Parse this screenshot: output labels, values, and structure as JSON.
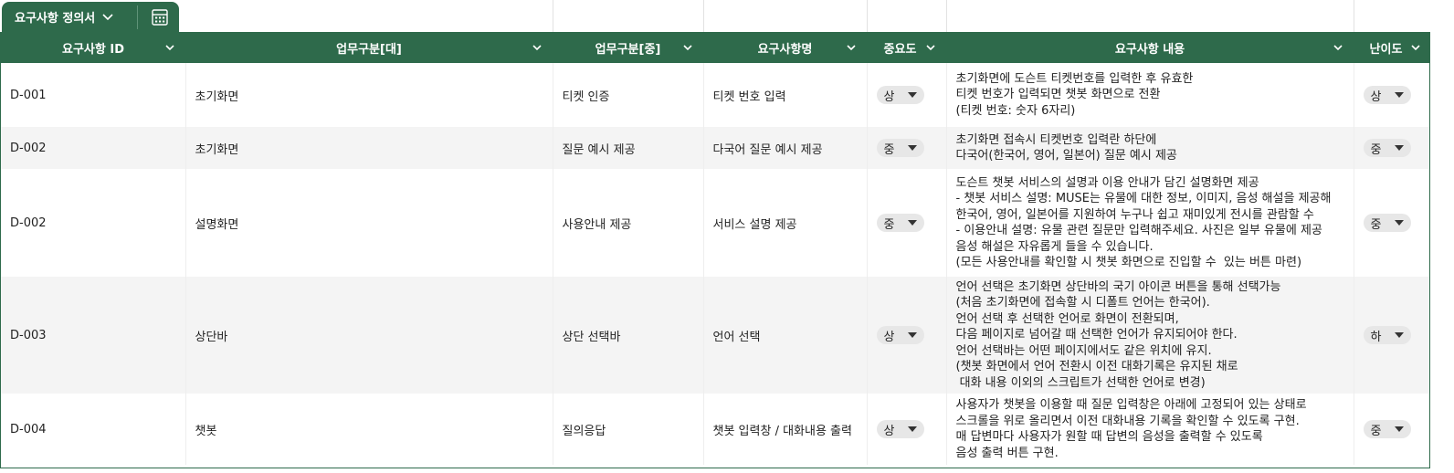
{
  "sheet_tab": {
    "label": "요구사항 정의서"
  },
  "columns": [
    "요구사항 ID",
    "업무구분[대]",
    "업무구분[중]",
    "요구사항명",
    "중요도",
    "요구사항 내용",
    "난이도"
  ],
  "rows": [
    {
      "id": "D-001",
      "major": "초기화면",
      "minor": "티켓 인증",
      "name": "티켓 번호 입력",
      "priority": "상",
      "content": "초기화면에 도슨트 티켓번호를 입력한 후 유효한\n티켓 번호가 입력되면 챗봇 화면으로 전환\n(티켓 번호: 숫자 6자리)",
      "difficulty": "상"
    },
    {
      "id": "D-002",
      "major": "초기화면",
      "minor": "질문 예시 제공",
      "name": "다국어 질문 예시 제공",
      "priority": "중",
      "content": "초기화면 접속시 티켓번호 입력란 하단에\n다국어(한국어, 영어, 일본어) 질문 예시 제공",
      "difficulty": "중"
    },
    {
      "id": "D-002",
      "major": "설명화면",
      "minor": "사용안내 제공",
      "name": "서비스 설명 제공",
      "priority": "중",
      "content": "도슨트 챗봇 서비스의 설명과 이용 안내가 담긴 설명화면 제공\n- 챗봇 서비스 설명: MUSE는 유물에 대한 정보, 이미지, 음성 해설을 제공해\n한국어, 영어, 일본어를 지원하여 누구나 쉽고 재미있게 전시를 관람할 수\n- 이용안내 설명: 유물 관련 질문만 입력해주세요. 사진은 일부 유물에 제공\n음성 해설은 자유롭게 들을 수 있습니다.\n(모든 사용안내를 확인할 시 챗봇 화면으로 진입할 수  있는 버튼 마련)",
      "difficulty": "중"
    },
    {
      "id": "D-003",
      "major": "상단바",
      "minor": "상단 선택바",
      "name": "언어 선택",
      "priority": "상",
      "content": "언어 선택은 초기화면 상단바의 국기 아이콘 버튼을 통해 선택가능\n(처음 초기화면에 접속할 시 디폴트 언어는 한국어).\n언어 선택 후 선택한 언어로 화면이 전환되며,\n다음 페이지로 넘어갈 때 선택한 언어가 유지되어야 한다.\n언어 선택바는 어떤 페이지에서도 같은 위치에 유지.\n(챗봇 화면에서 언어 전환시 이전 대화기록은 유지된 채로\n 대화 내용 이외의 스크립트가 선택한 언어로 변경)",
      "difficulty": "하"
    },
    {
      "id": "D-004",
      "major": "챗봇",
      "minor": "질의응답",
      "name": "챗봇 입력창 / 대화내용 출력",
      "priority": "상",
      "content": "사용자가 챗봇을 이용할 때 질문 입력창은 아래에 고정되어 있는 상태로\n스크롤을 위로 올리면서 이전 대화내용 기록을 확인할 수 있도록 구현.\n매 답변마다 사용자가 원할 때 답변의 음성을 출력할 수 있도록\n음성 출력 버튼 구현.",
      "difficulty": "중"
    }
  ]
}
